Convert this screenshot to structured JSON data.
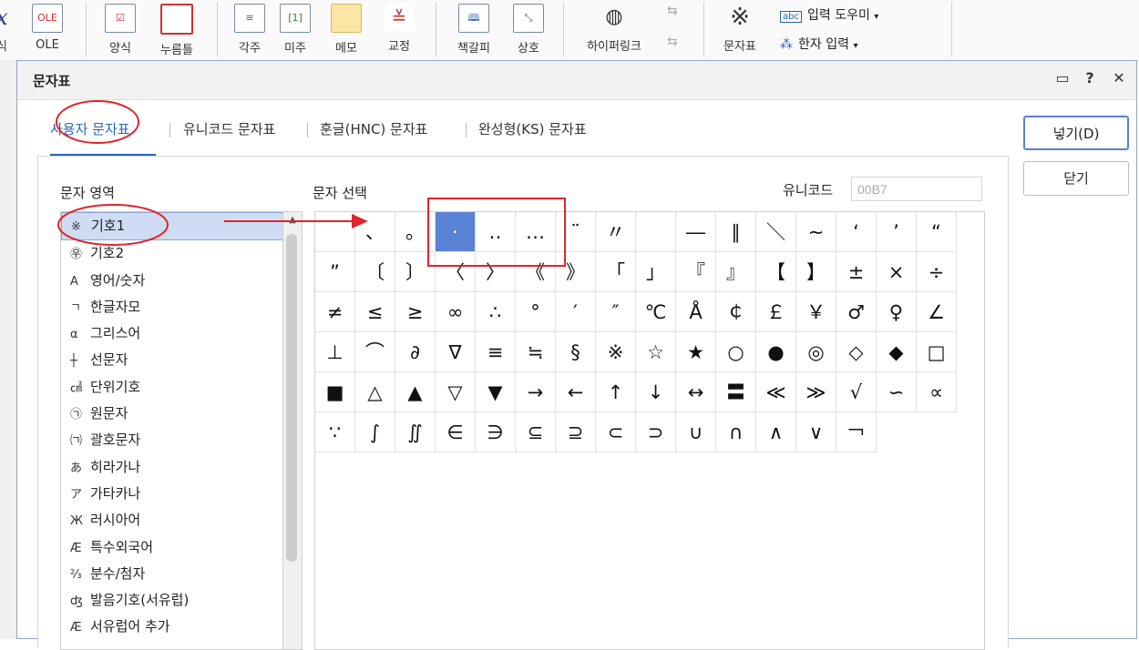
{
  "ribbon": {
    "items": [
      {
        "label": "식",
        "icon": "formula-icon"
      },
      {
        "label": "OLE",
        "icon": "ole-icon",
        "badge": "OLE"
      },
      {
        "label": "양식",
        "icon": "form-icon"
      },
      {
        "label": "누름틀",
        "icon": "field-icon"
      },
      {
        "label": "각주",
        "icon": "footnote-icon"
      },
      {
        "label": "미주",
        "icon": "endnote-icon",
        "badge": "[1]"
      },
      {
        "label": "메모",
        "icon": "memo-icon"
      },
      {
        "label": "교정",
        "icon": "proofread-icon"
      },
      {
        "label": "책갈피",
        "icon": "bookmark-icon"
      },
      {
        "label": "상호",
        "icon": "crossref-icon"
      },
      {
        "label": "하이퍼링크",
        "icon": "hyperlink-icon"
      },
      {
        "label": "문자표",
        "icon": "charmap-icon"
      }
    ],
    "input_helper": "입력 도우미",
    "hanja_input": "한자 입력",
    "input_helper_badge": "abc"
  },
  "dialog": {
    "title": "문자표",
    "tabs": [
      "사용자 문자표",
      "유니코드 문자표",
      "훈글(HNC) 문자표",
      "완성형(KS) 문자표"
    ],
    "active_tab": 0,
    "area_label": "문자 영역",
    "select_label": "문자 선택",
    "unicode_label": "유니코드",
    "unicode_value": "00B7",
    "insert_button": "넣기(D)",
    "close_button": "닫기",
    "categories": [
      {
        "icon": "※",
        "label": "기호1",
        "selected": true
      },
      {
        "icon": "㉾",
        "label": "기호2"
      },
      {
        "icon": "A",
        "label": "영어/숫자"
      },
      {
        "icon": "ㄱ",
        "label": "한글자모"
      },
      {
        "icon": "α",
        "label": "그리스어"
      },
      {
        "icon": "┼",
        "label": "선문자"
      },
      {
        "icon": "㎠",
        "label": "단위기호"
      },
      {
        "icon": "㉠",
        "label": "원문자"
      },
      {
        "icon": "㈀",
        "label": "괄호문자"
      },
      {
        "icon": "あ",
        "label": "히라가나"
      },
      {
        "icon": "ア",
        "label": "가타카나"
      },
      {
        "icon": "Ж",
        "label": "러시아어"
      },
      {
        "icon": "Æ",
        "label": "특수외국어"
      },
      {
        "icon": "⅔",
        "label": "분수/첨자"
      },
      {
        "icon": "ʤ",
        "label": "발음기호(서유럽)"
      },
      {
        "icon": "Æ",
        "label": "서유럽어 추가"
      }
    ],
    "chars": [
      [
        " ",
        "、",
        "。",
        "·",
        "‥",
        "…",
        "¨",
        "〃",
        "­",
        "―",
        "∥",
        "＼",
        "∼",
        "‘",
        "’",
        "“"
      ],
      [
        "”",
        "〔",
        "〕",
        "〈",
        "〉",
        "《",
        "》",
        "「",
        "」",
        "『",
        "』",
        "【",
        "】",
        "±",
        "×",
        "÷"
      ],
      [
        "≠",
        "≤",
        "≥",
        "∞",
        "∴",
        "°",
        "′",
        "″",
        "℃",
        "Å",
        "￠",
        "￡",
        "￥",
        "♂",
        "♀",
        "∠"
      ],
      [
        "⊥",
        "⌒",
        "∂",
        "∇",
        "≡",
        "≒",
        "§",
        "※",
        "☆",
        "★",
        "○",
        "●",
        "◎",
        "◇",
        "◆",
        "□"
      ],
      [
        "■",
        "△",
        "▲",
        "▽",
        "▼",
        "→",
        "←",
        "↑",
        "↓",
        "↔",
        "〓",
        "≪",
        "≫",
        "√",
        "∽",
        "∝"
      ],
      [
        "∵",
        "∫",
        "∬",
        "∈",
        "∋",
        "⊆",
        "⊇",
        "⊂",
        "⊃",
        "∪",
        "∩",
        "∧",
        "∨",
        "￢"
      ]
    ],
    "selected_char": [
      0,
      3
    ]
  }
}
